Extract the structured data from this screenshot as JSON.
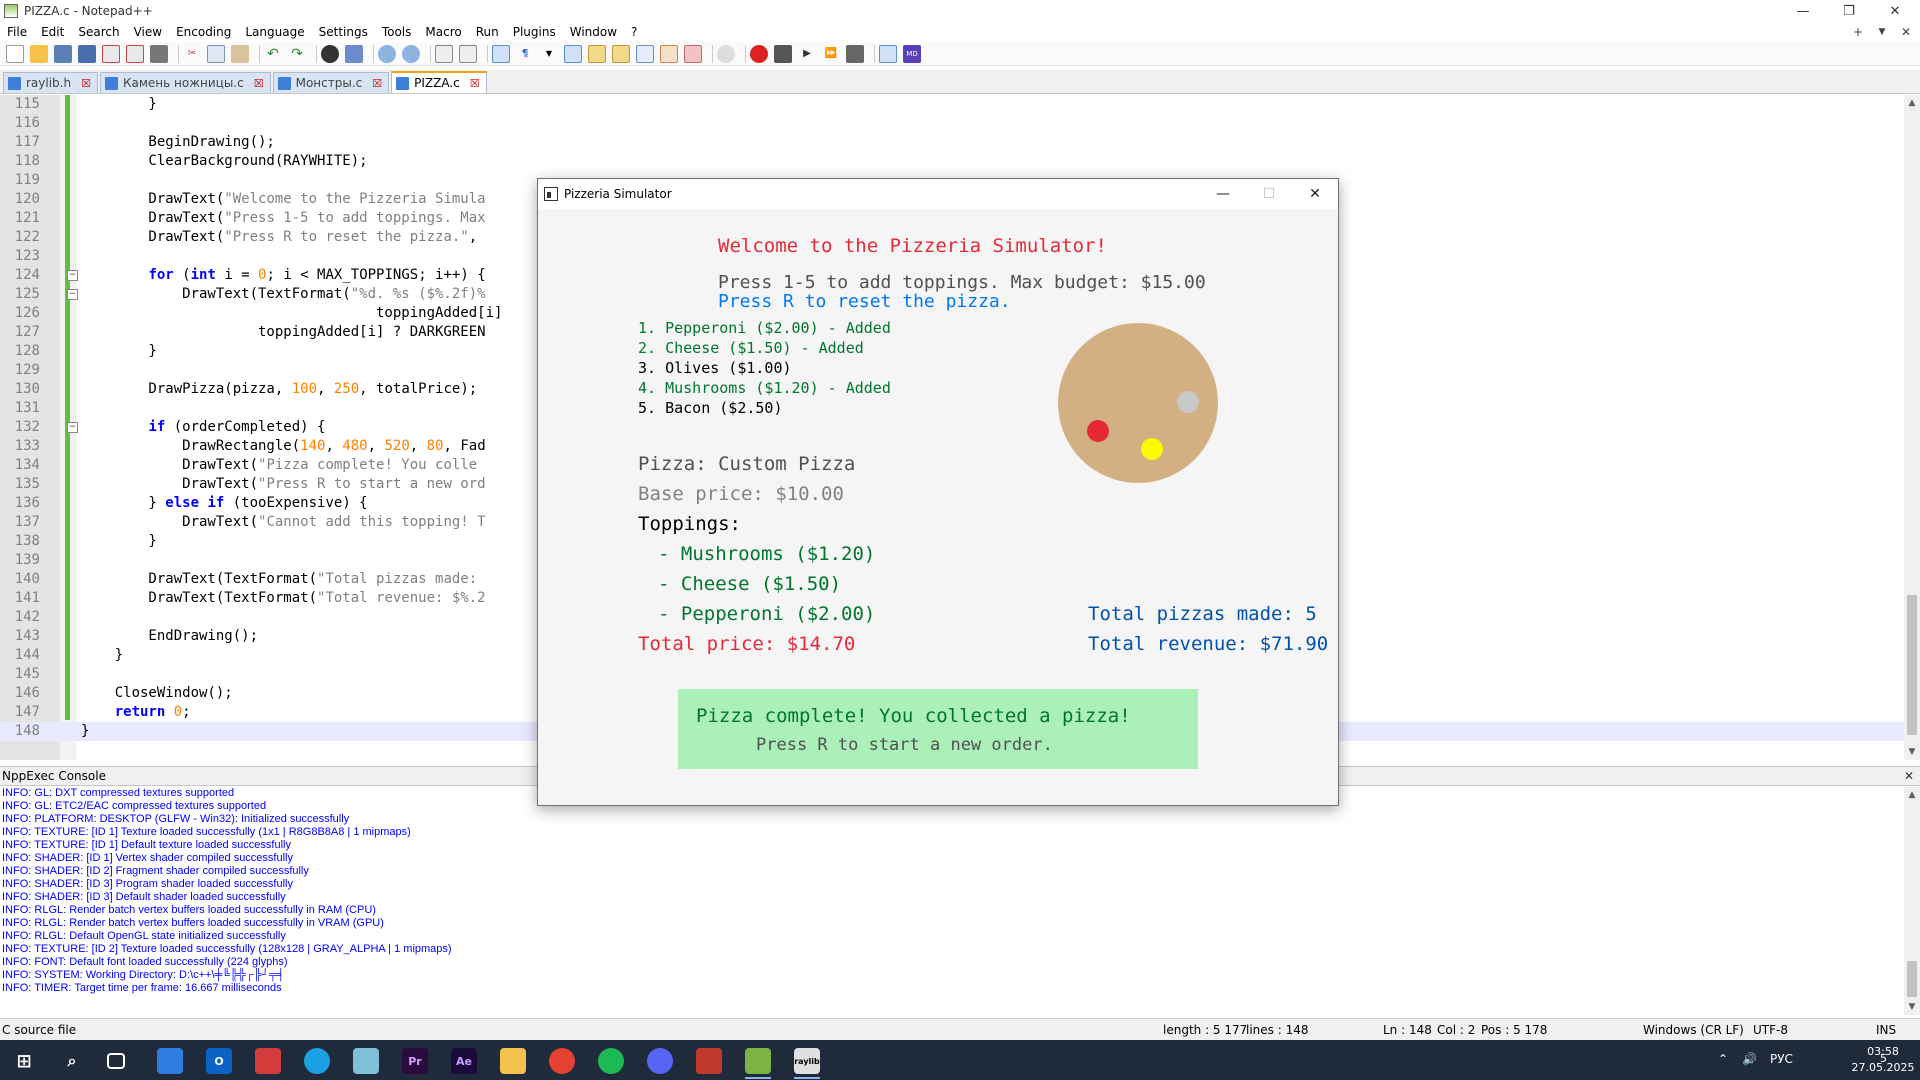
{
  "window": {
    "title": "PIZZA.c - Notepad++",
    "minimize": "—",
    "maximize": "❐",
    "close": "✕"
  },
  "menu": [
    "File",
    "Edit",
    "Search",
    "View",
    "Encoding",
    "Language",
    "Settings",
    "Tools",
    "Macro",
    "Run",
    "Plugins",
    "Window",
    "?"
  ],
  "menu_right": {
    "add": "+",
    "down": "▼",
    "close": "✕"
  },
  "tabs": [
    {
      "label": "raylib.h",
      "active": false
    },
    {
      "label": "Камень ножницы.c",
      "active": false
    },
    {
      "label": "Монстры.c",
      "active": false
    },
    {
      "label": "PIZZA.c",
      "active": true
    }
  ],
  "code": [
    {
      "n": "115",
      "t": "        }"
    },
    {
      "n": "116",
      "t": ""
    },
    {
      "n": "117",
      "t": "        BeginDrawing();"
    },
    {
      "n": "118",
      "t": "        ClearBackground(RAYWHITE);"
    },
    {
      "n": "119",
      "t": ""
    },
    {
      "n": "120",
      "t": "        DrawText(\"Welcome to the Pizzeria Simula"
    },
    {
      "n": "121",
      "t": "        DrawText(\"Press 1-5 to add toppings. Max"
    },
    {
      "n": "122",
      "t": "        DrawText(\"Press R to reset the pizza.\","
    },
    {
      "n": "123",
      "t": ""
    },
    {
      "n": "124",
      "t": "        for (int i = 0; i < MAX_TOPPINGS; i++) {"
    },
    {
      "n": "125",
      "t": "            DrawText(TextFormat(\"%d. %s ($%.2f)%"
    },
    {
      "n": "126",
      "t": "                                   toppingAdded[i]"
    },
    {
      "n": "127",
      "t": "                     toppingAdded[i] ? DARKGREEN"
    },
    {
      "n": "128",
      "t": "        }"
    },
    {
      "n": "129",
      "t": ""
    },
    {
      "n": "130",
      "t": "        DrawPizza(pizza, 100, 250, totalPrice);"
    },
    {
      "n": "131",
      "t": ""
    },
    {
      "n": "132",
      "t": "        if (orderCompleted) {"
    },
    {
      "n": "133",
      "t": "            DrawRectangle(140, 480, 520, 80, Fad"
    },
    {
      "n": "134",
      "t": "            DrawText(\"Pizza complete! You colle"
    },
    {
      "n": "135",
      "t": "            DrawText(\"Press R to start a new ord"
    },
    {
      "n": "136",
      "t": "        } else if (tooExpensive) {"
    },
    {
      "n": "137",
      "t": "            DrawText(\"Cannot add this topping! T"
    },
    {
      "n": "138",
      "t": "        }"
    },
    {
      "n": "139",
      "t": ""
    },
    {
      "n": "140",
      "t": "        DrawText(TextFormat(\"Total pizzas made:"
    },
    {
      "n": "141",
      "t": "        DrawText(TextFormat(\"Total revenue: $%.2"
    },
    {
      "n": "142",
      "t": ""
    },
    {
      "n": "143",
      "t": "        EndDrawing();"
    },
    {
      "n": "144",
      "t": "    }"
    },
    {
      "n": "145",
      "t": ""
    },
    {
      "n": "146",
      "t": "    CloseWindow();"
    },
    {
      "n": "147",
      "t": "    return 0;"
    },
    {
      "n": "148",
      "t": "}"
    }
  ],
  "console": {
    "title": "NppExec Console",
    "close": "✕",
    "lines": [
      "INFO: GL: DXT compressed textures supported",
      "INFO: GL: ETC2/EAC compressed textures supported",
      "INFO: PLATFORM: DESKTOP (GLFW - Win32): Initialized successfully",
      "INFO: TEXTURE: [ID 1] Texture loaded successfully (1x1 | R8G8B8A8 | 1 mipmaps)",
      "INFO: TEXTURE: [ID 1] Default texture loaded successfully",
      "INFO: SHADER: [ID 1] Vertex shader compiled successfully",
      "INFO: SHADER: [ID 2] Fragment shader compiled successfully",
      "INFO: SHADER: [ID 3] Program shader loaded successfully",
      "INFO: SHADER: [ID 3] Default shader loaded successfully",
      "INFO: RLGL: Render batch vertex buffers loaded successfully in RAM (CPU)",
      "INFO: RLGL: Render batch vertex buffers loaded successfully in VRAM (GPU)",
      "INFO: RLGL: Default OpenGL state initialized successfully",
      "INFO: TEXTURE: [ID 2] Texture loaded successfully (128x128 | GRAY_ALPHA | 1 mipmaps)",
      "INFO: FONT: Default font loaded successfully (224 glyphs)",
      "INFO: SYSTEM: Working Directory: D:\\c++\\╪╚╠╬┌╠┘╤╡",
      "INFO: TIMER: Target time per frame: 16.667 milliseconds"
    ]
  },
  "status": {
    "file_type": "C source file",
    "length": "length : 5 177",
    "lines": "lines : 148",
    "ln": "Ln : 148",
    "col": "Col : 2",
    "pos": "Pos : 5 178",
    "eol": "Windows (CR LF)",
    "encoding": "UTF-8",
    "mode": "INS"
  },
  "game": {
    "title": "Pizzeria Simulator",
    "min": "—",
    "max": "☐",
    "close": "✕",
    "welcome": "Welcome to the Pizzeria Simulator!",
    "instructions": "Press 1-5 to add toppings. Max budget: $15.00",
    "reset_hint": "Press R to reset the pizza.",
    "toppings_list": [
      {
        "text": "1. Pepperoni ($2.00) - Added",
        "added": true
      },
      {
        "text": "2. Cheese ($1.50) - Added",
        "added": true
      },
      {
        "text": "3. Olives ($1.00)",
        "added": false
      },
      {
        "text": "4. Mushrooms ($1.20) - Added",
        "added": true
      },
      {
        "text": "5. Bacon ($2.50)",
        "added": false
      }
    ],
    "pizza_name": "Pizza: Custom Pizza",
    "base_price": "Base price: $10.00",
    "toppings_header": "Toppings:",
    "selected_toppings": [
      "- Mushrooms ($1.20)",
      "- Cheese ($1.50)",
      "- Pepperoni ($2.00)"
    ],
    "total_price": "Total price: $14.70",
    "total_pizzas": "Total pizzas made: 5",
    "total_revenue": "Total revenue: $71.90",
    "complete_line1": "Pizza complete! You collected a pizza!",
    "complete_line2": "Press R to start a new order.",
    "colors": {
      "red": "#e62937",
      "darkgray": "#505050",
      "blue": "#0079f1",
      "darkgreen": "#00752c",
      "darkblue": "#0052ac",
      "gray": "#828282",
      "crust": "#d3b083",
      "complete_bg": "#acf0b9"
    }
  },
  "taskbar": {
    "lang": "РУС",
    "time": "03:58",
    "date": "27.05.2025",
    "notifications": "5"
  }
}
